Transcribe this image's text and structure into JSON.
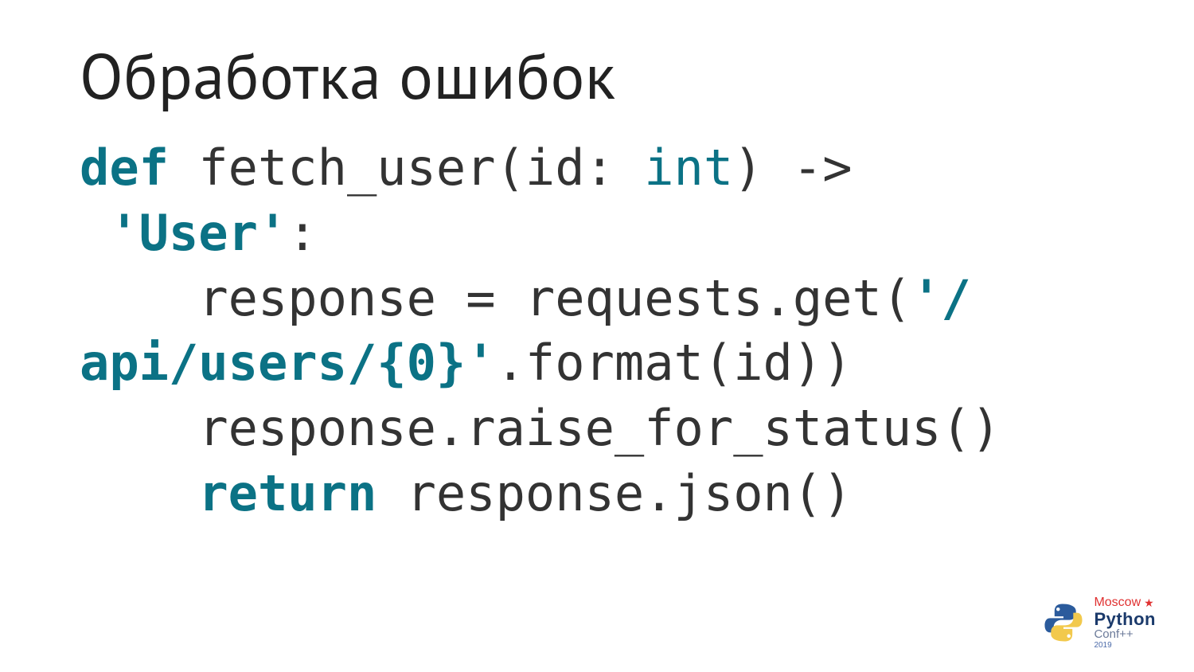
{
  "title": "Обработка ошибок",
  "code": {
    "line1": {
      "def": "def",
      "space1": " ",
      "fn": "fetch_user(id",
      "colon1": ": ",
      "type": "int",
      "close": ") ->"
    },
    "line2": {
      "space0": " ",
      "str": "'User'",
      "colon": ":"
    },
    "line3": {
      "indent": "    ",
      "a": "response = requests.get(",
      "q": "'/"
    },
    "line4": {
      "str": "api/users/{0}'",
      "rest": ".format(id))"
    },
    "line5": {
      "indent": "    ",
      "text": "response.raise_for_status()"
    },
    "line6": {
      "indent": "    ",
      "ret": "return",
      "space": " ",
      "rest": "response.json()"
    }
  },
  "logo": {
    "line1": "Moscow",
    "line2": "Python",
    "line3": "Conf++",
    "line4": "2019"
  }
}
